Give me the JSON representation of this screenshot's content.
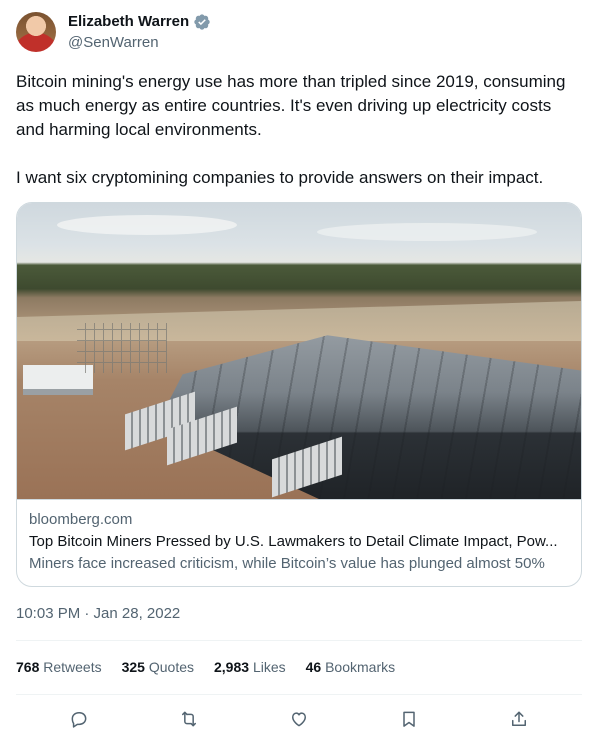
{
  "author": {
    "name": "Elizabeth Warren",
    "handle": "@SenWarren",
    "verified_icon": "verified-badge-icon",
    "badge_color": "#829aab"
  },
  "tweet": {
    "text": "Bitcoin mining's energy use has more than tripled since 2019, consuming as much energy as entire countries. It's even driving up electricity costs and harming local environments.\n\nI want six cryptomining companies to provide answers on their impact."
  },
  "link_card": {
    "domain": "bloomberg.com",
    "title": "Top Bitcoin Miners Pressed by U.S. Lawmakers to Detail Climate Impact, Pow...",
    "description": "Miners face increased criticism, while Bitcoin’s value has plunged almost 50%"
  },
  "timestamp": "10:03 PM · Jan 28, 2022",
  "stats": {
    "retweets_count": "768",
    "retweets_label": "Retweets",
    "quotes_count": "325",
    "quotes_label": "Quotes",
    "likes_count": "2,983",
    "likes_label": "Likes",
    "bookmarks_count": "46",
    "bookmarks_label": "Bookmarks"
  },
  "actions": {
    "icons": [
      "reply-icon",
      "retweet-icon",
      "like-icon",
      "bookmark-icon",
      "share-icon"
    ],
    "icon_color": "#536471"
  }
}
